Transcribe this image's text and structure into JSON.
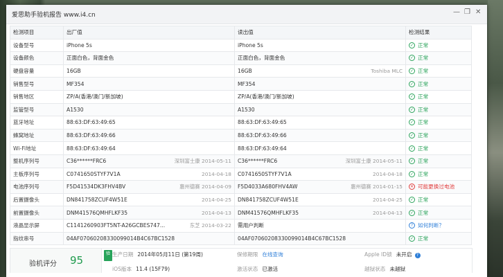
{
  "window": {
    "title": "爱思助手验机报告 www.i4.cn"
  },
  "headers": [
    "检测项目",
    "出厂值",
    "读出值",
    "检测结果"
  ],
  "rows": [
    {
      "item": "设备型号",
      "factory": "iPhone 5s",
      "factory_note": "",
      "read": "iPhone 5s",
      "read_note": "",
      "status": "正常",
      "status_type": "ok"
    },
    {
      "item": "设备颜色",
      "factory": "正面白色，背面金色",
      "factory_note": "",
      "read": "正面白色，背面金色",
      "read_note": "",
      "status": "正常",
      "status_type": "ok"
    },
    {
      "item": "硬盘容量",
      "factory": "16GB",
      "factory_note": "",
      "read": "16GB",
      "read_note": "Toshiba MLC",
      "status": "正常",
      "status_type": "ok"
    },
    {
      "item": "销售型号",
      "factory": "MF354",
      "factory_note": "",
      "read": "MF354",
      "read_note": "",
      "status": "正常",
      "status_type": "ok"
    },
    {
      "item": "销售地区",
      "factory": "ZP/A(香港/澳门/新加坡)",
      "factory_note": "",
      "read": "ZP/A(香港/澳门/新加坡)",
      "read_note": "",
      "status": "正常",
      "status_type": "ok"
    },
    {
      "item": "监管型号",
      "factory": "A1530",
      "factory_note": "",
      "read": "A1530",
      "read_note": "",
      "status": "正常",
      "status_type": "ok"
    },
    {
      "item": "蓝牙地址",
      "factory": "88:63:DF:63:49:65",
      "factory_note": "",
      "read": "88:63:DF:63:49:65",
      "read_note": "",
      "status": "正常",
      "status_type": "ok"
    },
    {
      "item": "蜂窝地址",
      "factory": "88:63:DF:63:49:66",
      "factory_note": "",
      "read": "88:63:DF:63:49:66",
      "read_note": "",
      "status": "正常",
      "status_type": "ok"
    },
    {
      "item": "Wi-Fi地址",
      "factory": "88:63:DF:63:49:64",
      "factory_note": "",
      "read": "88:63:DF:63:49:64",
      "read_note": "",
      "status": "正常",
      "status_type": "ok"
    },
    {
      "item": "整机序列号",
      "factory": "C36******FRC6",
      "factory_note": "深圳富士康 2014-05-11",
      "read": "C36******FRC6",
      "read_note": "深圳富士康 2014-05-11",
      "status": "正常",
      "status_type": "ok"
    },
    {
      "item": "主板序列号",
      "factory": "C0741650STYF7V1A",
      "factory_note": "2014-04-18",
      "read": "C0741650STYF7V1A",
      "read_note": "2014-04-18",
      "status": "正常",
      "status_type": "ok"
    },
    {
      "item": "电池序列号",
      "factory": "F5D41534DK3FHV4BV",
      "factory_note": "惠州德赛 2014-04-09",
      "read": "F5D4033A680FHV4AW",
      "read_note": "惠州德赛 2014-01-15",
      "status": "可能更换过电池",
      "status_type": "bad"
    },
    {
      "item": "后置摄像头",
      "factory": "DN841758ZCUF4W51E",
      "factory_note": "2014-04-25",
      "read": "DN841758ZCUF4W51E",
      "read_note": "2014-04-25",
      "status": "正常",
      "status_type": "ok"
    },
    {
      "item": "前置摄像头",
      "factory": "DNM41576QMHFLKF35",
      "factory_note": "2014-04-13",
      "read": "DNM41576QMHFLKF35",
      "read_note": "2014-04-13",
      "status": "正常",
      "status_type": "ok"
    },
    {
      "item": "液晶显示屏",
      "factory": "C1141260903FT5NT-A26GCBES747...",
      "factory_note": "东芝 2014-03-22",
      "read": "需用户判断",
      "read_note": "",
      "status": "如何判断？",
      "status_type": "ask"
    },
    {
      "item": "指纹串号",
      "factory": "04AF07060208330099014B4C67BC1528",
      "factory_note": "",
      "read": "04AF07060208330099014B4C67BC1528",
      "read_note": "",
      "status": "正常",
      "status_type": "ok"
    }
  ],
  "footer": {
    "score_label": "验机评分",
    "score_value": "95",
    "badge": "验",
    "prod_date_label": "生产日期",
    "prod_date_value": "2014年05月11日 (第19周)",
    "warranty_label": "保修期限",
    "warranty_value": "在线查询",
    "appleid_label": "Apple ID锁",
    "appleid_value": "未开启",
    "ios_label": "iOS版本",
    "ios_value": "11.4 (15F79)",
    "activation_label": "激活状态",
    "activation_value": "已激活",
    "jailbreak_label": "越狱状态",
    "jailbreak_value": "未越狱"
  },
  "colors": {
    "ok": "#2aa35a",
    "bad": "#e03c3c",
    "ask": "#2f7fd8"
  }
}
